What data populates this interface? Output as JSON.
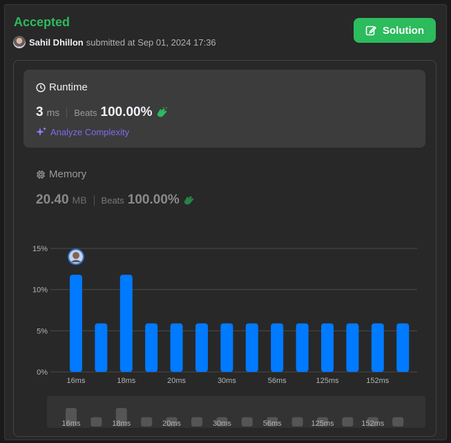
{
  "header": {
    "status": "Accepted",
    "user_name": "Sahil Dhillon",
    "submitted_text": "submitted at Sep 01, 2024 17:36",
    "solution_label": "Solution"
  },
  "runtime": {
    "title": "Runtime",
    "value": "3",
    "unit": "ms",
    "beats_label": "Beats",
    "beats_value": "100.00%",
    "analyze_label": "Analyze Complexity"
  },
  "memory": {
    "title": "Memory",
    "value": "20.40",
    "unit": "MB",
    "beats_label": "Beats",
    "beats_value": "100.00%"
  },
  "colors": {
    "accent_green": "#2cbb5d",
    "bar_blue": "#007aff",
    "analyze_purple": "#7c6cf0"
  },
  "chart_data": {
    "type": "bar",
    "ylabel": "",
    "xlabel": "",
    "ylim": [
      0,
      15
    ],
    "ytick_labels": [
      "0%",
      "5%",
      "10%",
      "15%"
    ],
    "yticks": [
      0,
      5,
      10,
      15
    ],
    "values": [
      11.8,
      5.9,
      11.8,
      5.9,
      5.9,
      5.9,
      5.9,
      5.9,
      5.9,
      5.9,
      5.9,
      5.9,
      5.9,
      5.9
    ],
    "xtick_labels": [
      "16ms",
      "18ms",
      "20ms",
      "30ms",
      "56ms",
      "125ms",
      "152ms"
    ],
    "xtick_bar_index": [
      0,
      2,
      4,
      6,
      8,
      10,
      12
    ],
    "user_bar_index": 0,
    "grid": true,
    "minimap_values": [
      11.8,
      5.9,
      11.8,
      5.9,
      5.9,
      5.9,
      5.9,
      5.9,
      5.9,
      5.9,
      5.9,
      5.9,
      5.9,
      5.9
    ]
  }
}
